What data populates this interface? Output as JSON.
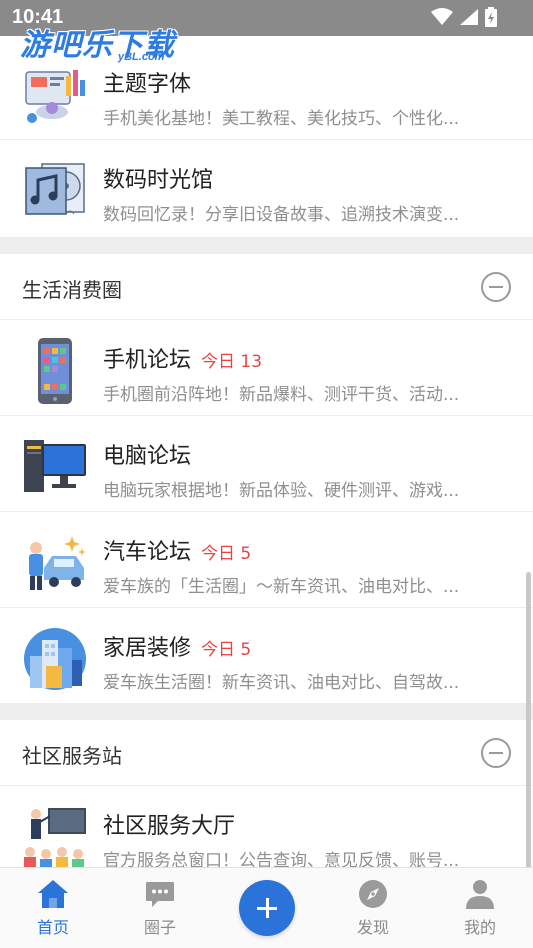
{
  "status_bar": {
    "time": "10:41",
    "icons": [
      "wifi-icon",
      "signal-icon",
      "battery-icon"
    ]
  },
  "watermark": {
    "text": "游吧乐下载",
    "sub": "yBL.com"
  },
  "forums_top": [
    {
      "title": "主题字体",
      "desc": "手机美化基地！美工教程、美化技巧、个性化...",
      "icon": "theme-font-illustration",
      "today": null
    },
    {
      "title": "数码时光馆",
      "desc": "数码回忆录！分享旧设备故事、追溯技术演变...",
      "icon": "digital-museum-illustration",
      "today": null
    }
  ],
  "sections": [
    {
      "title": "生活消费圈",
      "forums": [
        {
          "title": "手机论坛",
          "today": "今日 13",
          "desc": "手机圈前沿阵地！新品爆料、测评干货、活动...",
          "icon": "smartphone-illustration"
        },
        {
          "title": "电脑论坛",
          "today": null,
          "desc": "电脑玩家根据地！新品体验、硬件测评、游戏...",
          "icon": "desktop-pc-illustration"
        },
        {
          "title": "汽车论坛",
          "today": "今日 5",
          "desc": "爱车族的「生活圈」～新车资讯、油电对比、...",
          "icon": "car-wash-illustration"
        },
        {
          "title": "家居装修",
          "today": "今日 5",
          "desc": "爱车族生活圈！新车资讯、油电对比、自驾故...",
          "icon": "city-buildings-illustration"
        }
      ]
    },
    {
      "title": "社区服务站",
      "forums": [
        {
          "title": "社区服务大厅",
          "today": null,
          "desc": "官方服务总窗口！公告查询、意见反馈、账号...",
          "icon": "presentation-illustration"
        }
      ]
    }
  ],
  "tabbar": {
    "tabs": [
      {
        "label": "首页",
        "icon": "home-icon",
        "active": true
      },
      {
        "label": "圈子",
        "icon": "chat-bubble-icon",
        "active": false
      },
      {
        "label": "发现",
        "icon": "compass-icon",
        "active": false
      },
      {
        "label": "我的",
        "icon": "user-icon",
        "active": false
      }
    ],
    "post_icon": "plus-icon"
  },
  "colors": {
    "accent": "#2b73d9",
    "today_red": "#e64545",
    "desc_gray": "#8f8f8f",
    "divider": "#eeeeee"
  }
}
